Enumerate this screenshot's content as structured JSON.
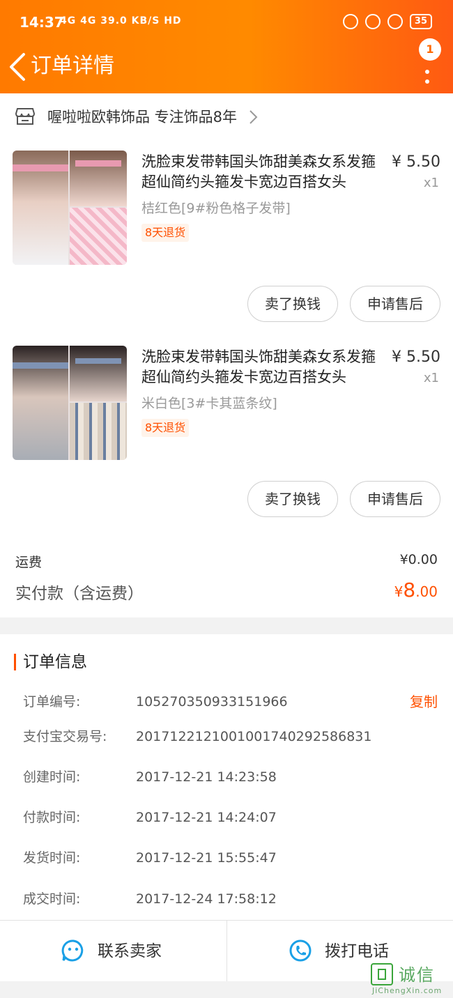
{
  "status_bar": {
    "time": "14:37",
    "network": "4G 4G 39.0 KB/S HD",
    "battery": "35"
  },
  "nav": {
    "title": "订单详情",
    "badge_count": "1"
  },
  "shop": {
    "name": "喔啦啦欧韩饰品 专注饰品8年"
  },
  "items": [
    {
      "title": "洗脸束发带韩国头饰甜美森女系发箍超仙简约头箍发卡宽边百搭女头",
      "price": "¥ 5.50",
      "qty": "x1",
      "sku": "桔红色[9#粉色格子发带]",
      "tag": "8天退货",
      "btn_sell": "卖了换钱",
      "btn_after": "申请售后"
    },
    {
      "title": "洗脸束发带韩国头饰甜美森女系发箍超仙简约头箍发卡宽边百搭女头",
      "price": "¥ 5.50",
      "qty": "x1",
      "sku": "米白色[3#卡其蓝条纹]",
      "tag": "8天退货",
      "btn_sell": "卖了换钱",
      "btn_after": "申请售后"
    }
  ],
  "summary": {
    "shipping_label": "运费",
    "shipping_value": "¥0.00",
    "paid_label": "实付款（含运费）",
    "paid_currency": "¥",
    "paid_int": "8",
    "paid_dec": ".00"
  },
  "order_info": {
    "title": "订单信息",
    "copy": "复制",
    "rows": [
      {
        "key": "订单编号:",
        "value": "105270350933151966"
      },
      {
        "key": "支付宝交易号:",
        "value": "2017122121001001740292586831"
      },
      {
        "key": "创建时间:",
        "value": "2017-12-21 14:23:58"
      },
      {
        "key": "付款时间:",
        "value": "2017-12-21 14:24:07"
      },
      {
        "key": "发货时间:",
        "value": "2017-12-21 15:55:47"
      },
      {
        "key": "成交时间:",
        "value": "2017-12-24 17:58:12"
      }
    ]
  },
  "bottom_bar": {
    "contact": "联系卖家",
    "call": "拨打电话"
  },
  "watermark": {
    "text": "诚信",
    "url": "JiChengXin.com"
  },
  "colors": {
    "accent": "#ff5000",
    "header": "#ff7a00",
    "blue_icon": "#1aa0e6"
  }
}
